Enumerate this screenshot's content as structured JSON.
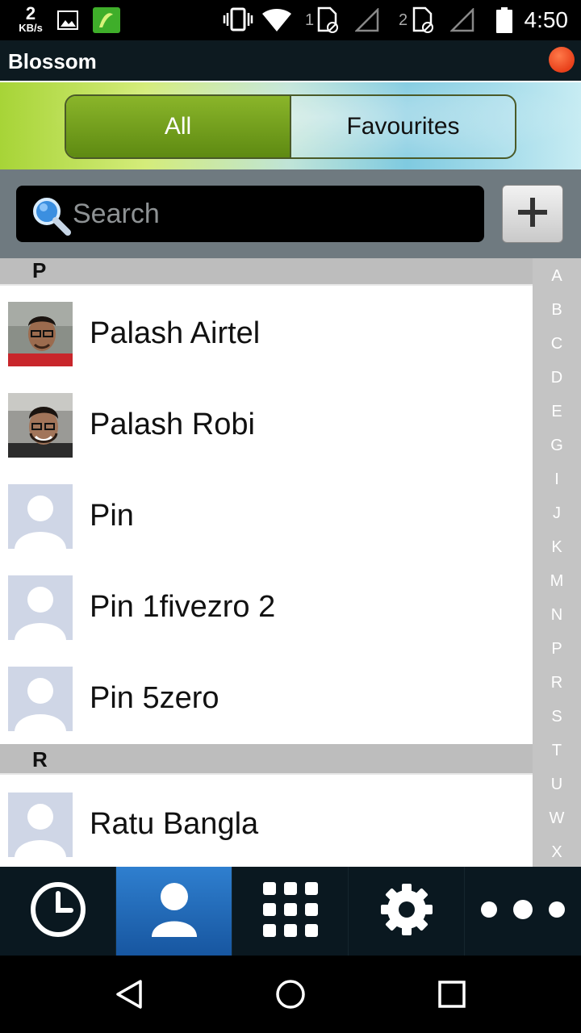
{
  "status_bar": {
    "speed_value": "2",
    "speed_unit": "KB/s",
    "sim1_label": "1",
    "sim2_label": "2",
    "time": "4:50"
  },
  "app": {
    "title": "Blossom"
  },
  "tabs": {
    "all_label": "All",
    "favourites_label": "Favourites",
    "selected": "All"
  },
  "search": {
    "placeholder": "Search",
    "value": ""
  },
  "contacts": {
    "sections": [
      {
        "letter": "P",
        "items": [
          {
            "name": "Palash Airtel",
            "avatar": "photo"
          },
          {
            "name": "Palash Robi",
            "avatar": "photo"
          },
          {
            "name": "Pin",
            "avatar": "placeholder"
          },
          {
            "name": "Pin 1fivezro 2",
            "avatar": "placeholder"
          },
          {
            "name": "Pin 5zero",
            "avatar": "placeholder"
          }
        ]
      },
      {
        "letter": "R",
        "items": [
          {
            "name": "Ratu Bangla",
            "avatar": "placeholder"
          }
        ]
      }
    ]
  },
  "alpha_index": [
    "A",
    "B",
    "C",
    "D",
    "E",
    "G",
    "I",
    "J",
    "K",
    "M",
    "N",
    "P",
    "R",
    "S",
    "T",
    "U",
    "W",
    "X"
  ],
  "bottom_tabs": [
    {
      "icon": "clock-icon",
      "active": false
    },
    {
      "icon": "person-icon",
      "active": true
    },
    {
      "icon": "dialpad-icon",
      "active": false
    },
    {
      "icon": "gear-icon",
      "active": false
    },
    {
      "icon": "more-dots-icon",
      "active": false
    }
  ],
  "colors": {
    "accent_green": "#6f9a1c",
    "active_tab_blue": "#1f6bb8",
    "status_dot": "#e8401a"
  }
}
